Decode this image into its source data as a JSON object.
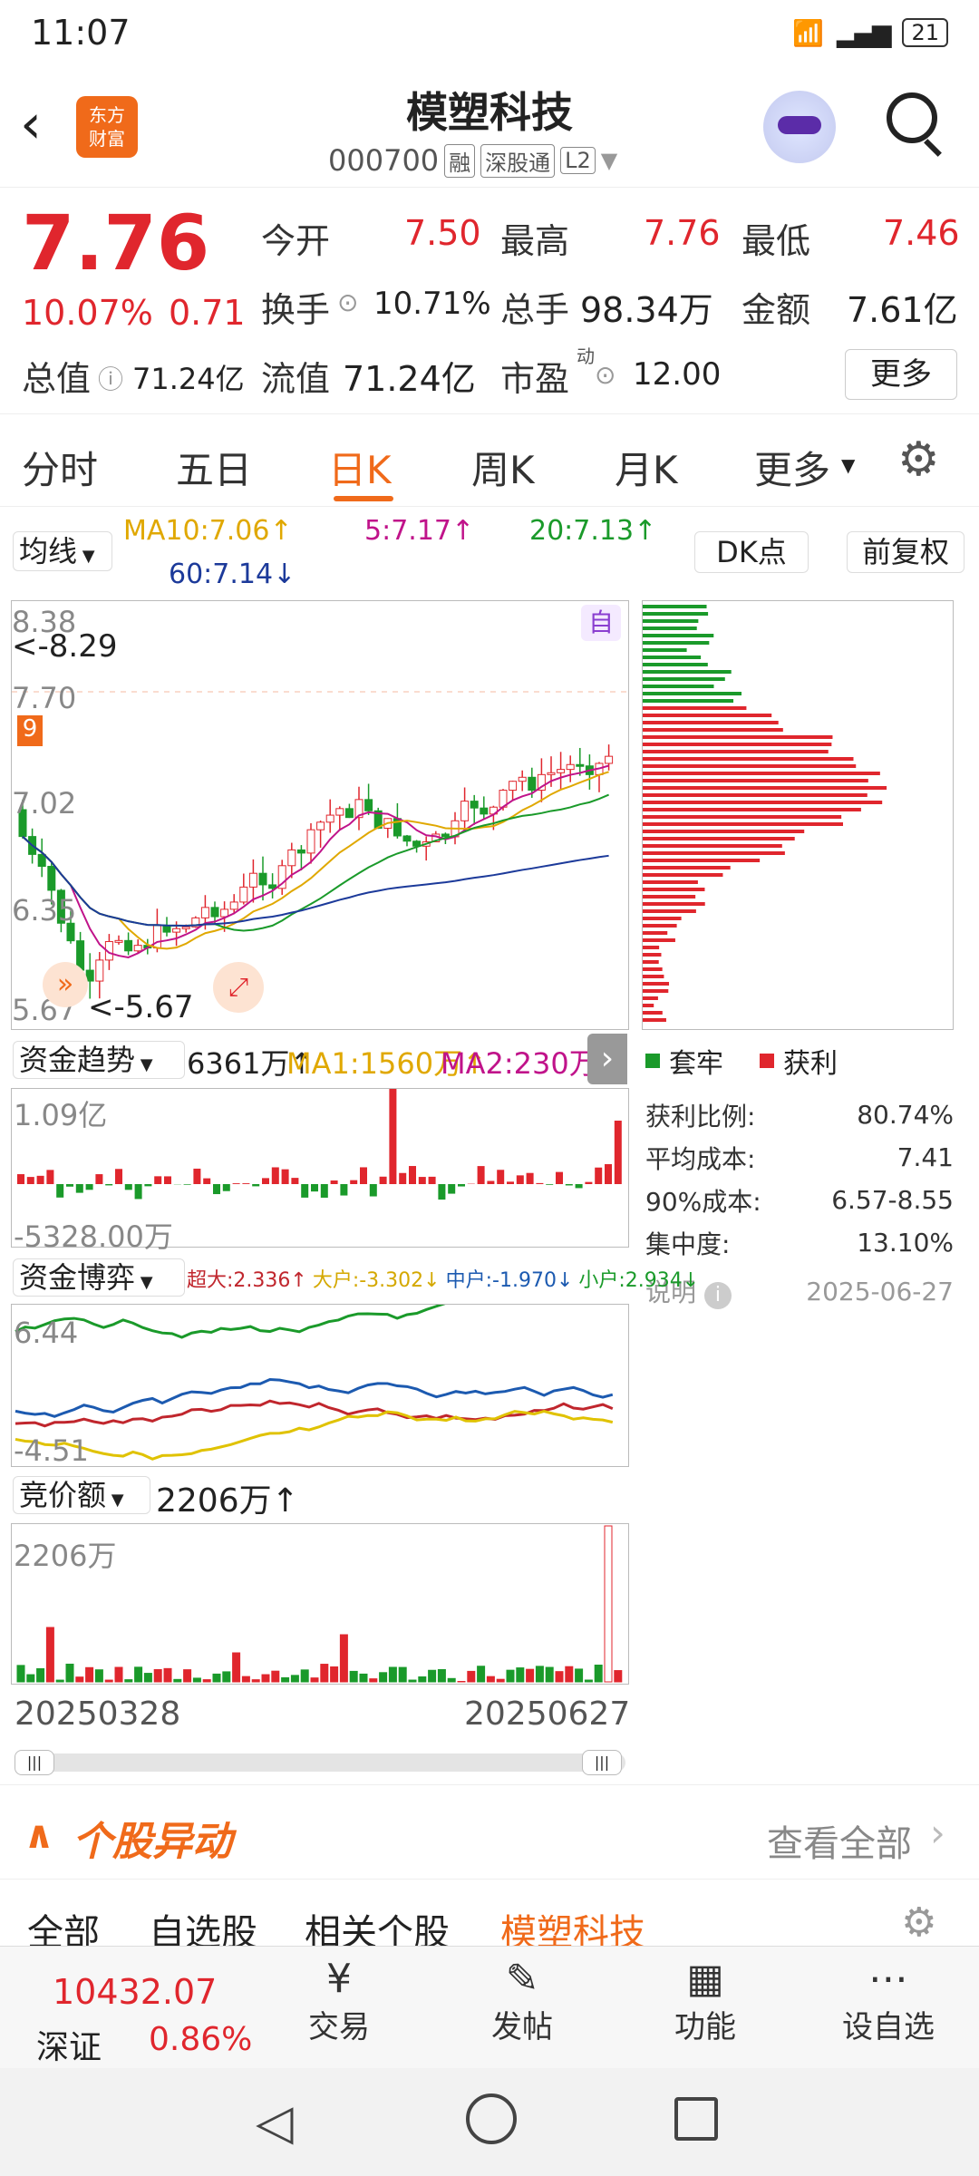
{
  "status": {
    "time": "11:07",
    "battery": "21"
  },
  "header": {
    "title": "模塑科技",
    "code": "000700",
    "tags": [
      "融",
      "深股通",
      "L2"
    ],
    "logo_line1": "东方",
    "logo_line2": "财富"
  },
  "quote": {
    "price": "7.76",
    "pct": "10.07%",
    "chg": "0.71",
    "open_label": "今开",
    "open": "7.50",
    "high_label": "最高",
    "high": "7.76",
    "low_label": "最低",
    "low": "7.46",
    "turnover_label": "换手",
    "turnover": "10.71%",
    "vol_label": "总手",
    "vol": "98.34万",
    "amt_label": "金额",
    "amt": "7.61亿",
    "mcap_label": "总值",
    "mcap": "71.24亿",
    "float_label": "流值",
    "float": "71.24亿",
    "pe_label": "市盈",
    "pe_sup": "动",
    "pe": "12.00",
    "more": "更多"
  },
  "tabs": [
    "分时",
    "五日",
    "日K",
    "周K",
    "月K",
    "更多"
  ],
  "ma": {
    "btn": "均线",
    "ma10": "MA10:7.06↑",
    "ma5": "5:7.17↑",
    "ma20": "20:7.13↑",
    "ma60": "60:7.14↓",
    "dk": "DK点",
    "fq": "前复权"
  },
  "kline": {
    "y_labels": [
      "8.38",
      "7.70",
      "7.02",
      "6.35",
      "5.67"
    ],
    "max_note": "<-8.29",
    "min_note": "<-5.67",
    "zi": "自",
    "badge": "9"
  },
  "fund": {
    "btn": "资金趋势",
    "v": "6361万↑",
    "ma1": "MA1:1560万↑",
    "ma2": "MA2:230万↑",
    "top": "1.09亿",
    "bottom": "-5328.00万"
  },
  "game": {
    "btn": "资金博弈",
    "super": "超大:2.336↑",
    "big": "大户:-3.302↓",
    "mid": "中户:-1.970↓",
    "small": "小户:2.934↓",
    "top": "6.44",
    "bottom": "-4.51"
  },
  "auction": {
    "btn": "竞价额",
    "v": "2206万↑",
    "top": "2206万",
    "d1": "20250328",
    "d2": "20250627"
  },
  "chip": {
    "trap": "套牢",
    "profit": "获利",
    "rows": [
      [
        "获利比例:",
        "80.74%"
      ],
      [
        "平均成本:",
        "7.41"
      ],
      [
        "90%成本:",
        "6.57-8.55"
      ],
      [
        "集中度:",
        "13.10%"
      ]
    ],
    "note": "说明",
    "date": "2025-06-27"
  },
  "movers": {
    "title": "个股异动",
    "all": "查看全部",
    "tabs": [
      "全部",
      "自选股",
      "相关个股",
      "模塑科技"
    ]
  },
  "nav": {
    "index_val": "10432.07",
    "index_name": "深证",
    "index_pct": "0.86%",
    "items": [
      "交易",
      "发帖",
      "功能",
      "设自选"
    ]
  },
  "colors": {
    "up": "#e0262d",
    "down": "#1a9a2a",
    "accent": "#f06a1a"
  }
}
